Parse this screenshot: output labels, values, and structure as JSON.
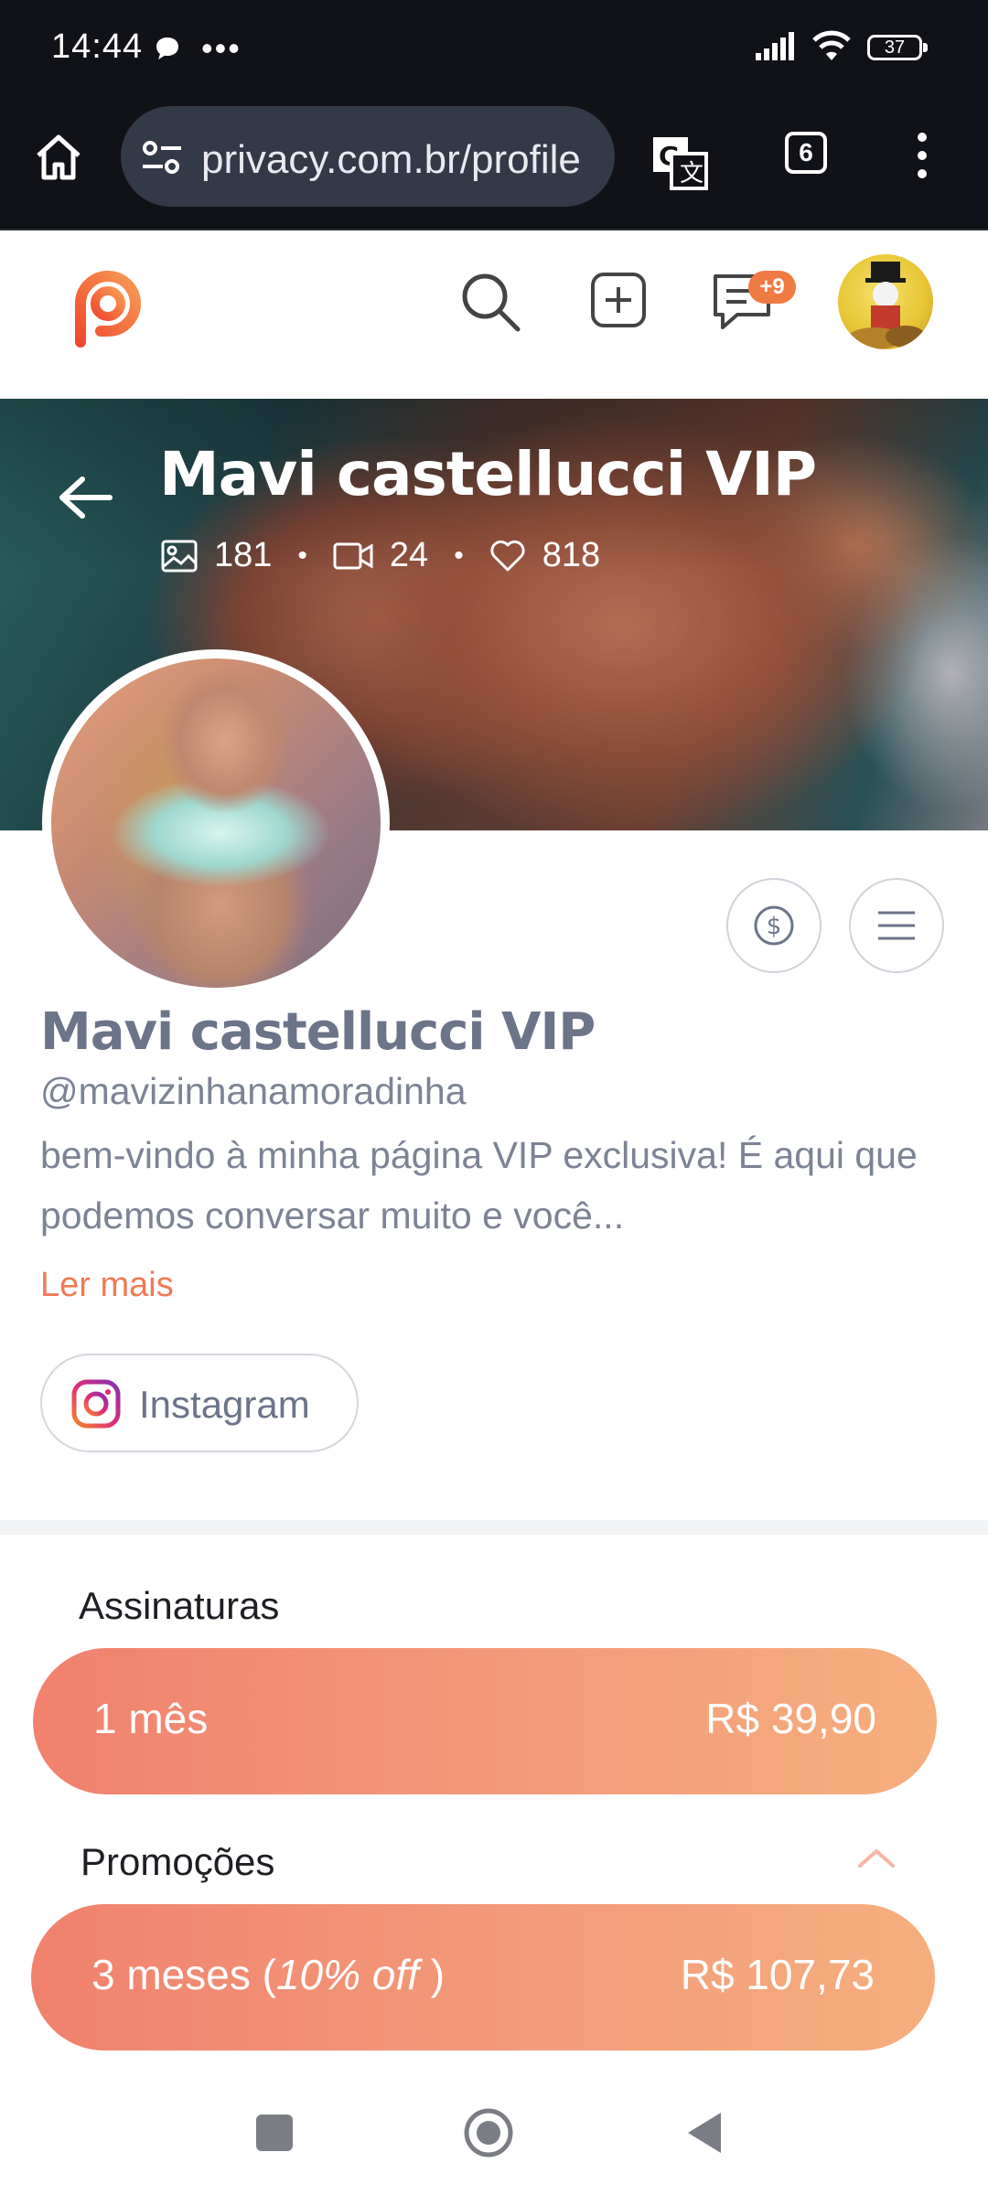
{
  "status_bar": {
    "time": "14:44",
    "more_indicator": "•••",
    "battery": "37"
  },
  "browser": {
    "url": "privacy.com.br/profile",
    "tab_count": "6"
  },
  "header": {
    "message_badge": "+9"
  },
  "cover": {
    "title": "Mavi castellucci VIP",
    "photos_count": "181",
    "videos_count": "24",
    "likes_count": "818",
    "separator": "•"
  },
  "profile": {
    "name": "Mavi castellucci VIP",
    "handle": "@mavizinhanamoradinha",
    "bio": "bem-vindo à minha página VIP exclusiva! É aqui que podemos conversar muito e você...",
    "read_more": "Ler mais",
    "instagram_label": "Instagram"
  },
  "subscriptions": {
    "label": "Assinaturas",
    "plan": {
      "duration": "1 mês",
      "price": "R$ 39,90"
    }
  },
  "promotions": {
    "label": "Promoções",
    "plan": {
      "duration": "3 meses (",
      "discount": "10% off",
      "close": " )",
      "price": "R$ 107,73"
    }
  },
  "colors": {
    "accent": "#f07a55",
    "plan_gradient_start": "#f0816e",
    "plan_gradient_end": "#f6ae7e",
    "text_muted": "#7c8394"
  }
}
